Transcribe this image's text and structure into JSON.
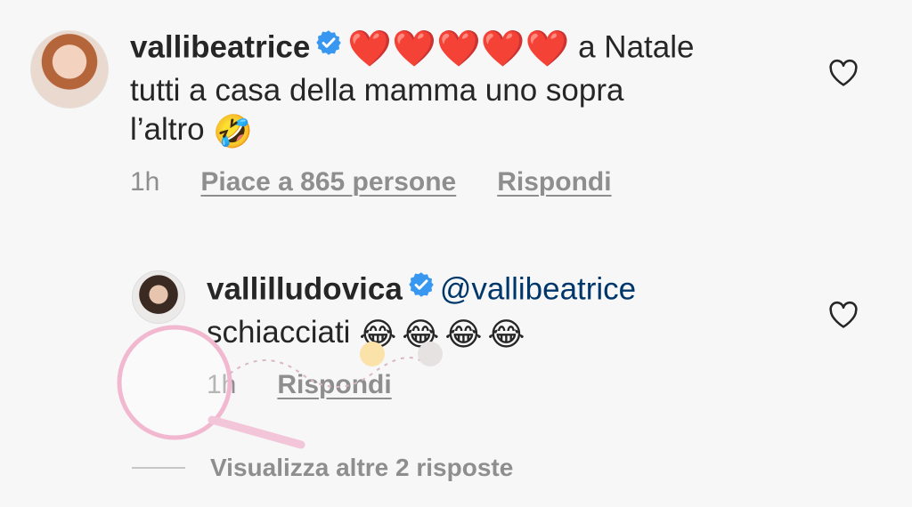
{
  "comments": [
    {
      "username": "vallibeatrice",
      "hearts": "❤️❤️❤️❤️❤️",
      "text_line1": "a Natale",
      "text_line2": "tutti a casa della mamma uno sopra",
      "text_line3": "l’altro",
      "emoji_end": "🤣",
      "time": "1h",
      "likes": "Piace a 865 persone",
      "reply": "Rispondi"
    },
    {
      "username": "vallilludovica",
      "mention": "@vallibeatrice",
      "text": "schiacciati",
      "emojis": "😂😂😂😂",
      "time": "1h",
      "reply": "Rispondi"
    }
  ],
  "view_more": "Visualizza altre 2 risposte",
  "colors": {
    "heart": "#ed4956",
    "verified": "#3897f0",
    "mention": "#00376b",
    "muted": "#8e8e8e"
  },
  "icons": [
    "verified-badge-icon",
    "heart-outline-icon"
  ]
}
